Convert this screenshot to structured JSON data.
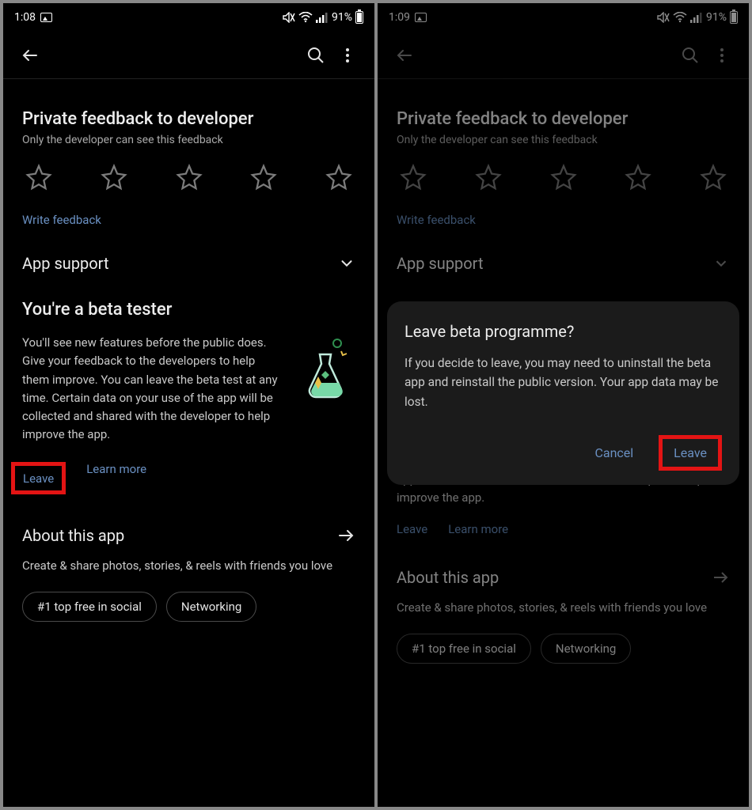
{
  "left": {
    "status": {
      "time": "1:08",
      "battery_percent": "91%"
    },
    "feedback": {
      "title": "Private feedback to developer",
      "subtitle": "Only the developer can see this feedback",
      "write_label": "Write feedback"
    },
    "support": {
      "title": "App support"
    },
    "beta": {
      "title": "You're a beta tester",
      "body": "You'll see new features before the public does. Give your feedback to the developers to help them improve. You can leave the beta test at any time. Certain data on your use of the app will be collected and shared with the developer to help improve the app.",
      "leave_label": "Leave",
      "learn_more_label": "Learn more"
    },
    "about": {
      "title": "About this app",
      "desc": "Create & share photos, stories, & reels with friends you love",
      "chip1": "#1 top free in social",
      "chip2": "Networking"
    }
  },
  "right": {
    "status": {
      "time": "1:09",
      "battery_percent": "91%"
    },
    "feedback": {
      "title": "Private feedback to developer",
      "subtitle": "Only the developer can see this feedback",
      "write_label": "Write feedback"
    },
    "support": {
      "title": "App support"
    },
    "beta": {
      "body_tail": "app will be collected and shared with the developer to help improve the app.",
      "leave_label": "Leave",
      "learn_more_label": "Learn more"
    },
    "about": {
      "title": "About this app",
      "desc": "Create & share photos, stories, & reels with friends you love",
      "chip1": "#1 top free in social",
      "chip2": "Networking"
    },
    "dialog": {
      "title": "Leave beta programme?",
      "body": "If you decide to leave, you may need to uninstall the beta app and reinstall the public version. Your app data may be lost.",
      "cancel": "Cancel",
      "leave": "Leave"
    }
  }
}
